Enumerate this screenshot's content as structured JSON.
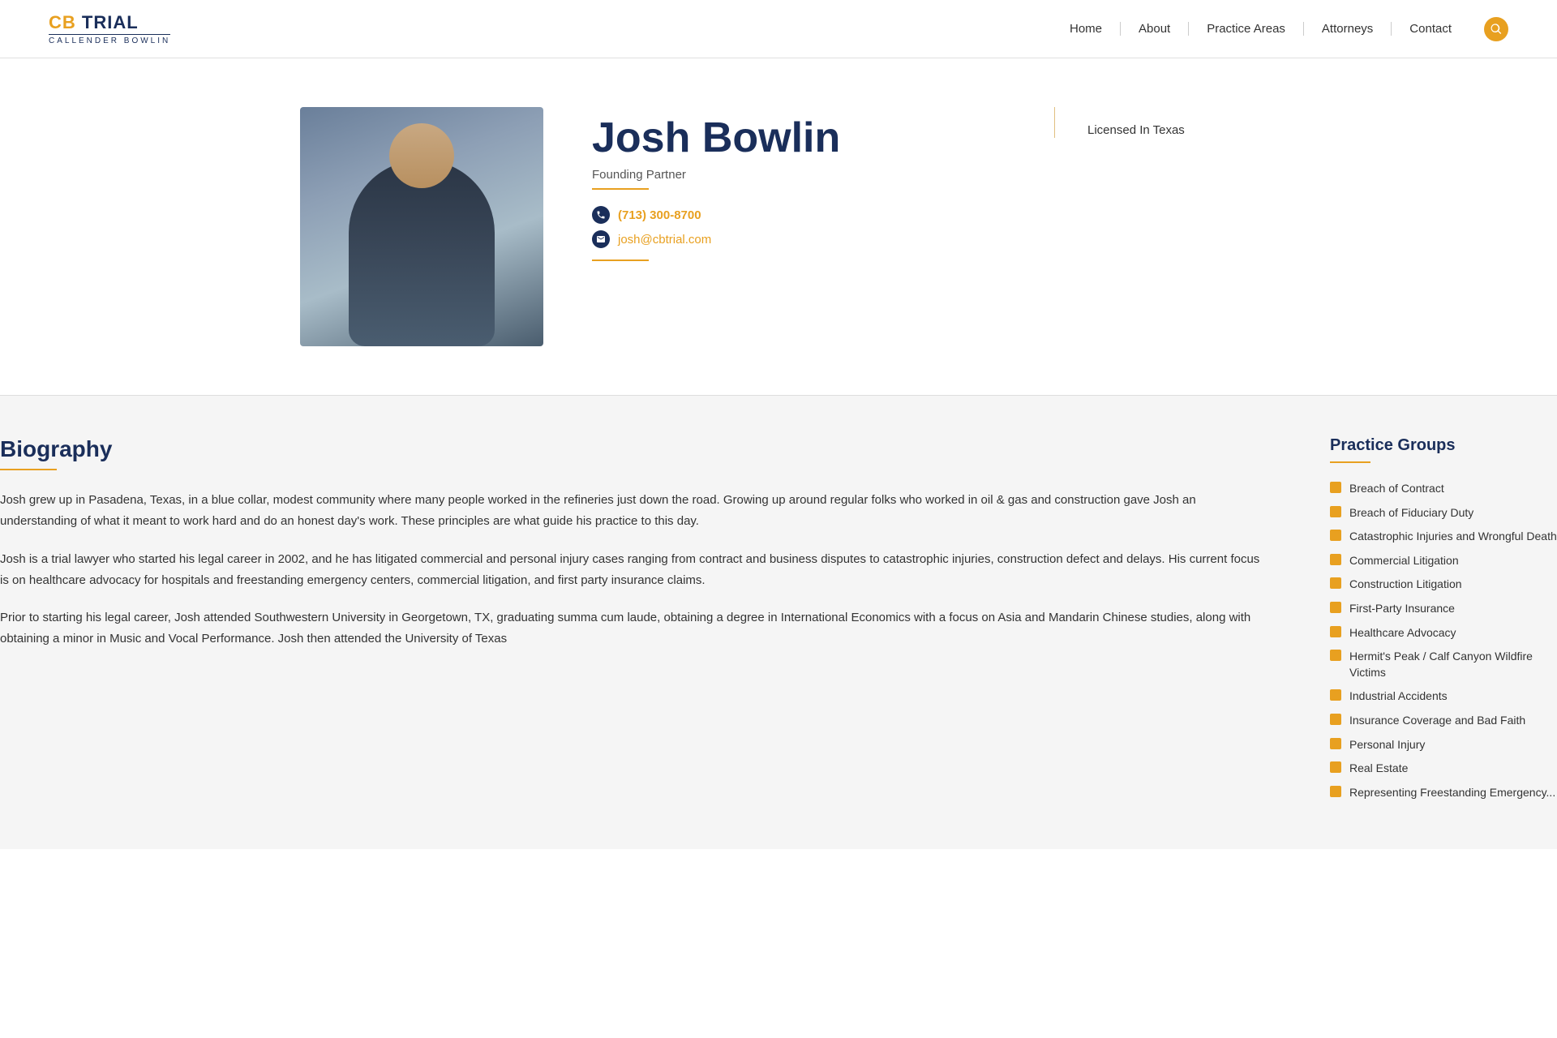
{
  "logo": {
    "top": "CB TRIAL",
    "sub": "Callender Bowlin"
  },
  "nav": {
    "links": [
      "Home",
      "About",
      "Practice Areas",
      "Attorneys",
      "Contact"
    ]
  },
  "attorney": {
    "name": "Josh Bowlin",
    "title": "Founding Partner",
    "phone": "(713) 300-8700",
    "email": "josh@cbtrial.com",
    "licensed": "Licensed In Texas"
  },
  "biography": {
    "heading": "Biography",
    "paragraphs": [
      "Josh grew up in Pasadena, Texas, in a blue collar, modest community where many people worked in the refineries just down the road.  Growing up around regular folks who worked in oil & gas and construction gave Josh an understanding of what it meant to work hard and do an honest day's work.  These principles are what guide his practice to this day.",
      "Josh is a trial lawyer who started his legal career in 2002, and he has litigated commercial and personal injury cases ranging from contract and business disputes to catastrophic injuries, construction defect and delays.  His current focus is on healthcare advocacy for hospitals and freestanding emergency centers, commercial litigation, and first party insurance claims.",
      "Prior to starting his legal career, Josh attended Southwestern University in Georgetown, TX, graduating summa cum laude, obtaining a degree in International Economics with a focus on Asia and Mandarin Chinese studies, along with obtaining a minor in Music and Vocal Performance. Josh then attended the University of Texas"
    ]
  },
  "practiceGroups": {
    "heading": "Practice Groups",
    "items": [
      "Breach of Contract",
      "Breach of Fiduciary Duty",
      "Catastrophic Injuries and Wrongful Death",
      "Commercial Litigation",
      "Construction Litigation",
      "First-Party Insurance",
      "Healthcare Advocacy",
      "Hermit's Peak / Calf Canyon Wildfire Victims",
      "Industrial Accidents",
      "Insurance Coverage and Bad Faith",
      "Personal Injury",
      "Real Estate",
      "Representing Freestanding Emergency..."
    ]
  }
}
